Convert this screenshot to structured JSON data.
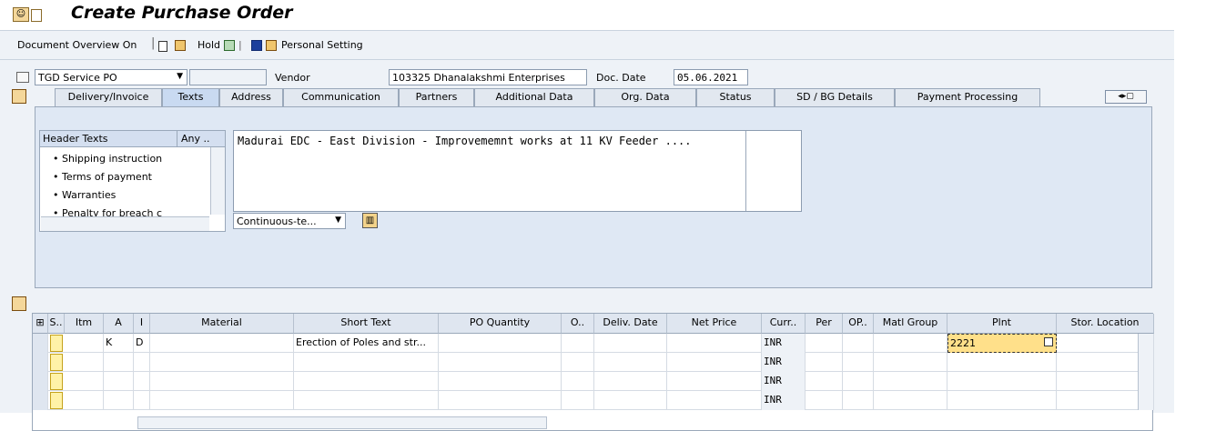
{
  "window": {
    "title": "Create Purchase Order"
  },
  "toolbar": {
    "doc_overview": "Document Overview On",
    "hold": "Hold",
    "personal_setting": "Personal Setting"
  },
  "header": {
    "doc_type": "TGD Service PO",
    "vendor_label": "Vendor",
    "vendor_value": "103325 Dhanalakshmi Enterprises",
    "doc_date_label": "Doc. Date",
    "doc_date_value": "05.06.2021"
  },
  "tabs": [
    "Delivery/Invoice",
    "Texts",
    "Address",
    "Communication",
    "Partners",
    "Additional Data",
    "Org. Data",
    "Status",
    "SD / BG Details",
    "Payment Processing"
  ],
  "texts_panel": {
    "header_col": "Header Texts",
    "any_col": "Any ..",
    "items": [
      "• Shipping instruction",
      "• Terms of payment",
      "• Warranties",
      "• Penalty for breach c"
    ],
    "editor_text": "Madurai EDC - East Division - Improvememnt works at 11 KV Feeder ....",
    "format_select": "Continuous-te..."
  },
  "grid": {
    "columns": [
      "S..",
      "Itm",
      "A",
      "I",
      "Material",
      "Short Text",
      "PO Quantity",
      "O..",
      "Deliv. Date",
      "Net Price",
      "Curr..",
      "Per",
      "OP..",
      "Matl Group",
      "Plnt",
      "Stor. Location"
    ],
    "rows": [
      {
        "A": "K",
        "I": "D",
        "short_text": "Erection of Poles and str...",
        "curr": "INR",
        "plnt": "2221"
      },
      {
        "A": "",
        "I": "",
        "short_text": "",
        "curr": "INR",
        "plnt": ""
      },
      {
        "A": "",
        "I": "",
        "short_text": "",
        "curr": "INR",
        "plnt": ""
      },
      {
        "A": "",
        "I": "",
        "short_text": "",
        "curr": "INR",
        "plnt": ""
      }
    ]
  }
}
